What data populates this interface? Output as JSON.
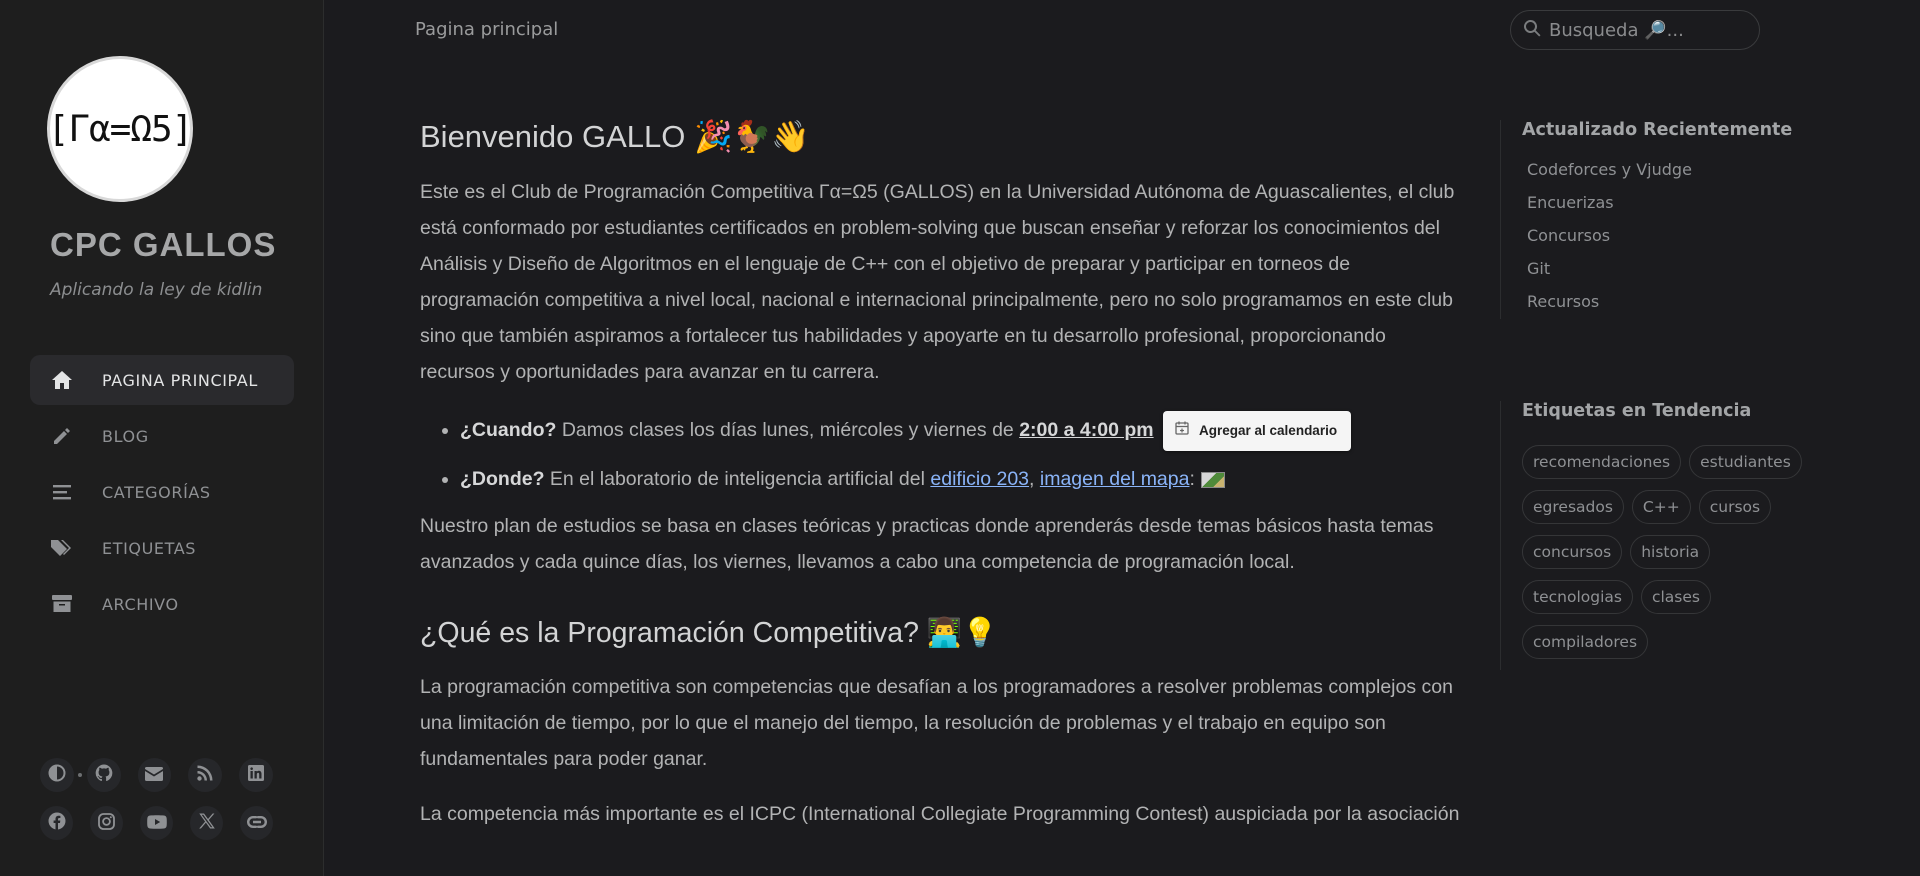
{
  "sidebar": {
    "avatar_text": "[Γα=Ω5]",
    "site_title": "CPC GALLOS",
    "site_subtitle": "Aplicando la ley de kidlin",
    "nav": [
      {
        "label": "PAGINA PRINCIPAL",
        "icon": "home-icon",
        "active": true
      },
      {
        "label": "BLOG",
        "icon": "pencil-icon"
      },
      {
        "label": "CATEGORÍAS",
        "icon": "stream-icon"
      },
      {
        "label": "ETIQUETAS",
        "icon": "tags-icon"
      },
      {
        "label": "ARCHIVO",
        "icon": "archive-icon"
      }
    ],
    "social_icons": [
      "theme-toggle-icon",
      "github-icon",
      "email-icon",
      "rss-icon",
      "linkedin-icon",
      "facebook-icon",
      "instagram-icon",
      "youtube-icon",
      "x-twitter-icon",
      "link-icon"
    ]
  },
  "topbar": {
    "breadcrumb": "Pagina principal",
    "search_placeholder": "Busqueda 🔎..."
  },
  "main": {
    "h1": "Bienvenido GALLO 🎉🐓👋",
    "p1": "Este es el Club de Programación Competitiva Γα=Ω5 (GALLOS) en la Universidad Autónoma de Aguascalientes, el club está conformado por estudiantes certificados en problem-solving que buscan enseñar y reforzar los conocimientos del Análisis y Diseño de Algoritmos en el lenguaje de C++ con el objetivo de preparar y participar en torneos de programación competitiva a nivel local, nacional e internacional principalmente, pero no solo programamos en este club sino que también aspiramos a fortalecer tus habilidades y apoyarte en tu desarrollo profesional, proporcionando recursos y oportunidades para avanzar en tu carrera.",
    "when_label": "¿Cuando?",
    "when_text": " Damos clases los días lunes, miércoles y viernes de ",
    "when_time": "2:00 a 4:00 pm",
    "calendar_button": "Agregar al calendario",
    "where_label": "¿Donde?",
    "where_text": " En el laboratorio de inteligencia artificial del ",
    "where_link1": "edificio 203",
    "comma": ", ",
    "where_link2": "imagen del mapa",
    "colon": ":",
    "p2": "Nuestro plan de estudios se basa en clases teóricas y practicas donde aprenderás desde temas básicos hasta temas avanzados y cada quince días, los viernes, llevamos a cabo una competencia de programación local.",
    "h2": "¿Qué es la Programación Competitiva? 👨‍💻💡",
    "p3": "La programación competitiva son competencias que desafían a los programadores a resolver problemas complejos con una limitación de tiempo, por lo que el manejo del tiempo, la resolución de problemas y el trabajo en equipo son fundamentales para poder ganar.",
    "p4": "La competencia más importante es el ICPC (International Collegiate Programming Contest) auspiciada por la asociación"
  },
  "panel": {
    "recent_title": "Actualizado Recientemente",
    "recent": [
      "Codeforces y Vjudge",
      "Encuerizas",
      "Concursos",
      "Git",
      "Recursos"
    ],
    "tags_title": "Etiquetas en Tendencia",
    "tags": [
      "recomendaciones",
      "estudiantes",
      "egresados",
      "C++",
      "cursos",
      "concursos",
      "historia",
      "tecnologias",
      "clases",
      "compiladores"
    ]
  }
}
